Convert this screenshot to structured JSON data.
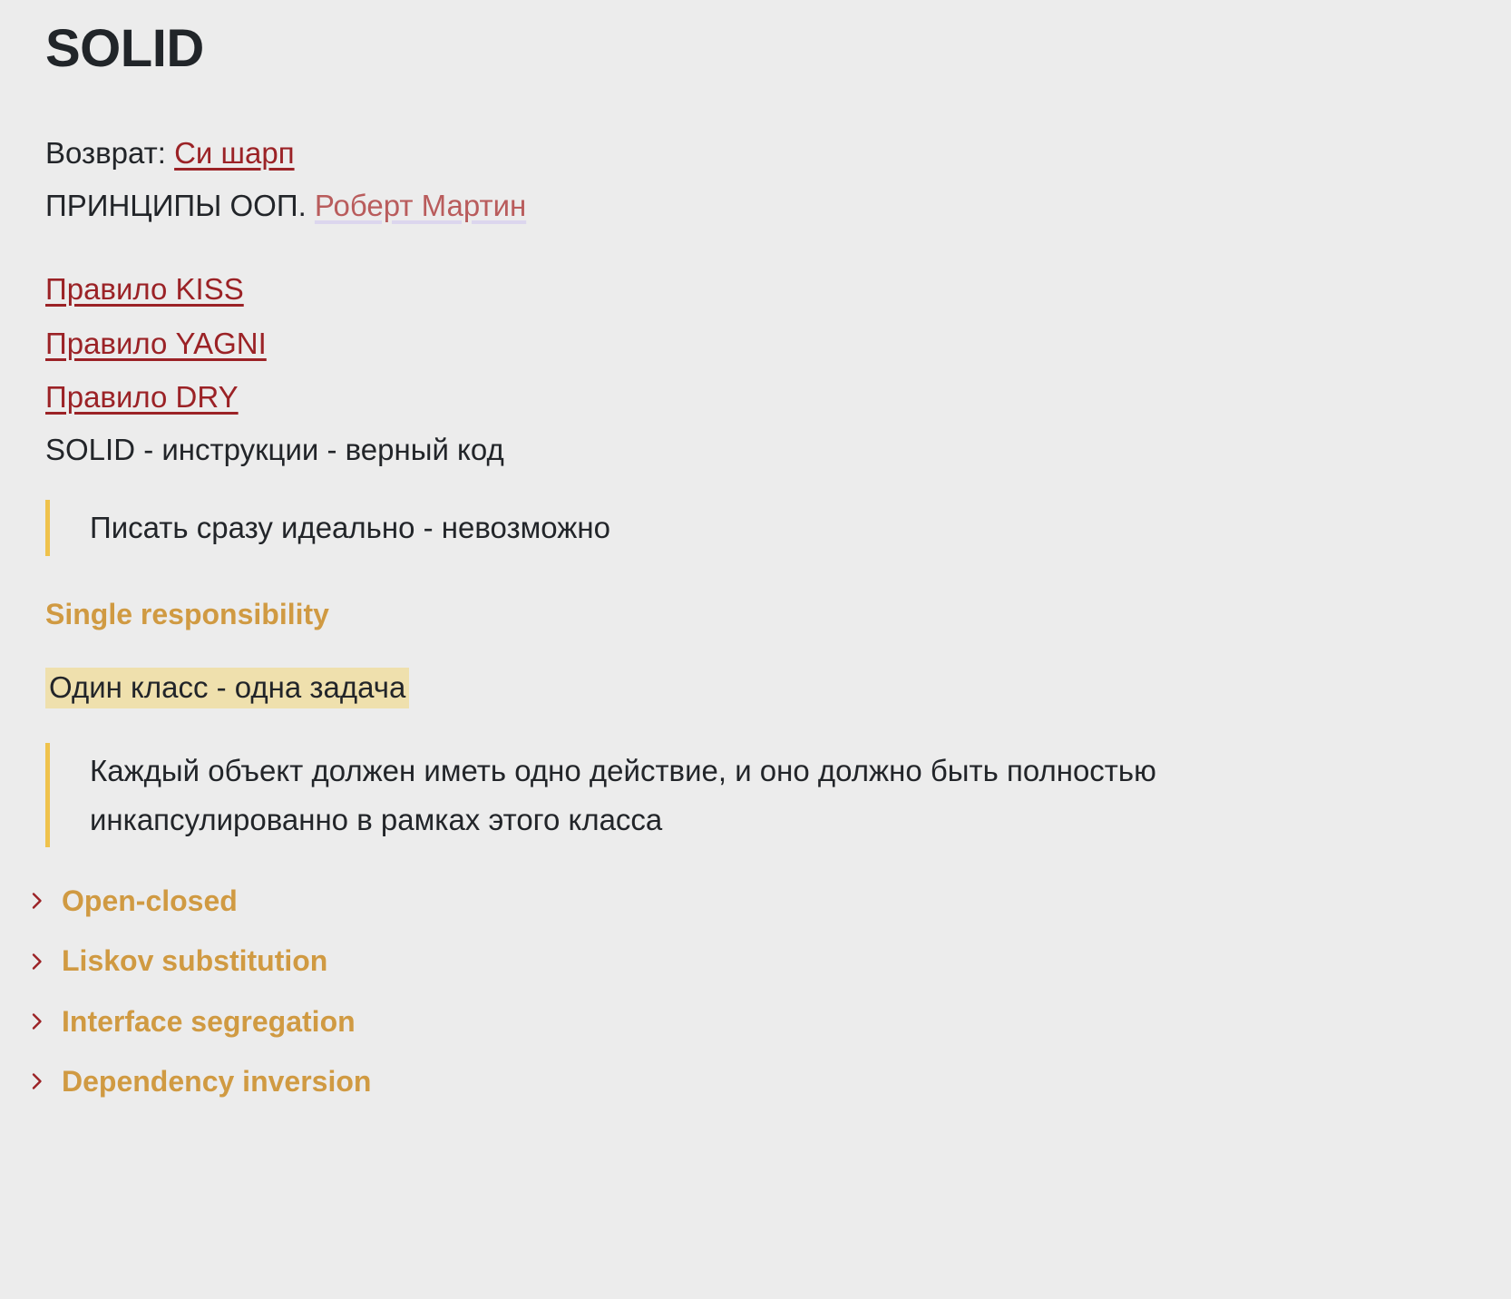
{
  "document": {
    "title": "SOLID"
  },
  "intro": {
    "return_label": "Возврат: ",
    "return_link": "Си шарп",
    "principles_prefix": "ПРИНЦИПЫ ООП. ",
    "author_link": "Роберт Мартин"
  },
  "rules": [
    {
      "label": "Правило KISS"
    },
    {
      "label": "Правило YAGNI"
    },
    {
      "label": "Правило DRY"
    }
  ],
  "statement": "SOLID - инструкции - верный код",
  "quote_intro": "Писать сразу идеально - невозможно",
  "single_responsibility": {
    "heading": "Single responsibility",
    "highlight": "Один класс - одна задача",
    "quote": "Каждый объект должен иметь одно действие, и оно должно быть полностью инкапсулированно в рамках этого класса"
  },
  "toggles": [
    {
      "label": "Open-closed",
      "icon": "chevron-right-icon"
    },
    {
      "label": "Liskov substitution",
      "icon": "chevron-right-icon"
    },
    {
      "label": "Interface segregation",
      "icon": "chevron-right-icon"
    },
    {
      "label": "Dependency inversion",
      "icon": "chevron-right-icon"
    }
  ],
  "colors": {
    "background": "#ECECEC",
    "text": "#212529",
    "link": "#9B2226",
    "link_muted": "#B95C5C",
    "accent": "#D09A42",
    "quote_border": "#EFC24C",
    "highlight": "#EFE0AD"
  }
}
